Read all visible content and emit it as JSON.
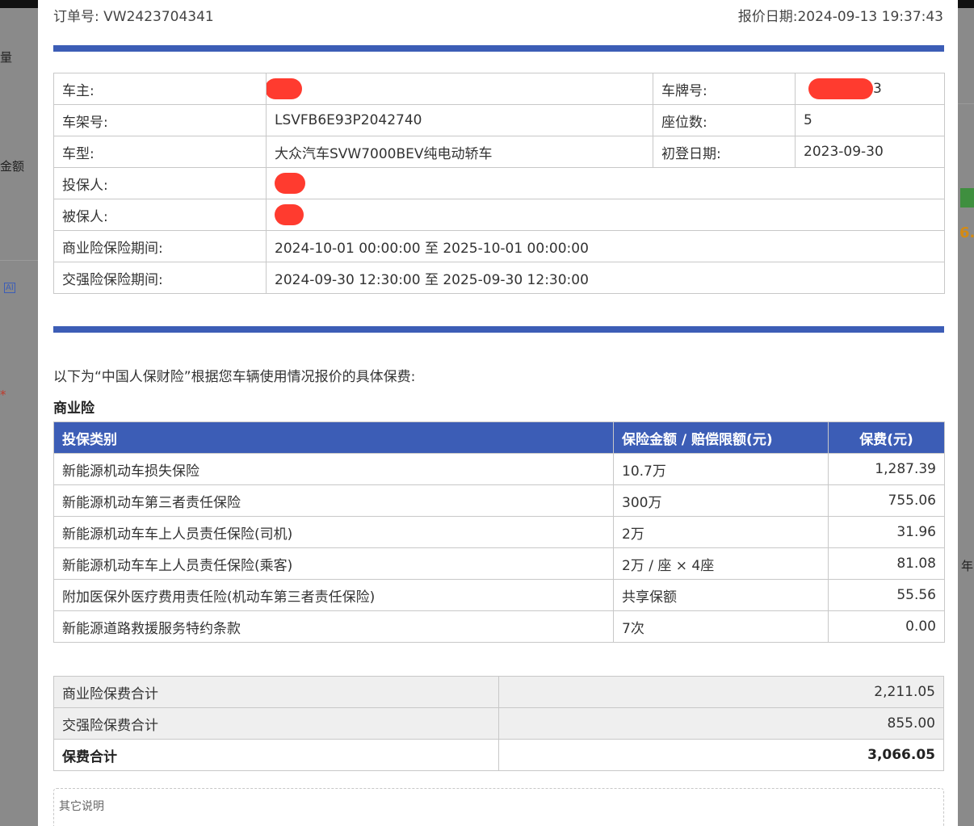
{
  "background": {
    "left_texts": [
      "量",
      "金额",
      "AI",
      "*"
    ],
    "right_texts": [
      "6.",
      "年"
    ]
  },
  "header": {
    "order_label": "订单号:",
    "order_no": "VW2423704341",
    "quote_date_label": "报价日期:",
    "quote_date": "2024-09-13 19:37:43"
  },
  "vehicle_info": {
    "owner_label": "车主:",
    "owner_suffix": "",
    "plate_label": "车牌号:",
    "plate_suffix": "3",
    "vin_label": "车架号:",
    "vin": "LSVFB6E93P2042740",
    "seats_label": "座位数:",
    "seats": "5",
    "model_label": "车型:",
    "model": "大众汽车SVW7000BEV纯电动轿车",
    "reg_date_label": "初登日期:",
    "reg_date": "2023-09-30",
    "applicant_label": "投保人:",
    "insured_label": "被保人:",
    "commercial_period_label": "商业险保险期间:",
    "commercial_period": "2024-10-01 00:00:00 至 2025-10-01 00:00:00",
    "compulsory_period_label": "交强险保险期间:",
    "compulsory_period": "2024-09-30 12:30:00 至 2025-09-30 12:30:00"
  },
  "intro_text": "以下为“中国人保财险”根据您车辆使用情况报价的具体保费:",
  "section_title": "商业险",
  "premium_table": {
    "headers": [
      "投保类别",
      "保险金额 / 赔偿限额(元)",
      "保费(元)"
    ],
    "rows": [
      [
        "新能源机动车损失保险",
        "10.7万",
        "1,287.39"
      ],
      [
        "新能源机动车第三者责任保险",
        "300万",
        "755.06"
      ],
      [
        "新能源机动车车上人员责任保险(司机)",
        "2万",
        "31.96"
      ],
      [
        "新能源机动车车上人员责任保险(乘客)",
        "2万 / 座 × 4座",
        "81.08"
      ],
      [
        "附加医保外医疗费用责任险(机动车第三者责任保险)",
        "共享保额",
        "55.56"
      ],
      [
        "新能源道路救援服务特约条款",
        "7次",
        "0.00"
      ]
    ]
  },
  "summary": {
    "commercial_label": "商业险保费合计",
    "commercial_total": "2,211.05",
    "compulsory_label": "交强险保费合计",
    "compulsory_total": "855.00",
    "grand_label": "保费合计",
    "grand_total": "3,066.05"
  },
  "notes_label": "其它说明",
  "colors": {
    "accent_blue": "#3c5db6",
    "redaction": "#ff3b2f",
    "summary_bg": "#efefef"
  }
}
